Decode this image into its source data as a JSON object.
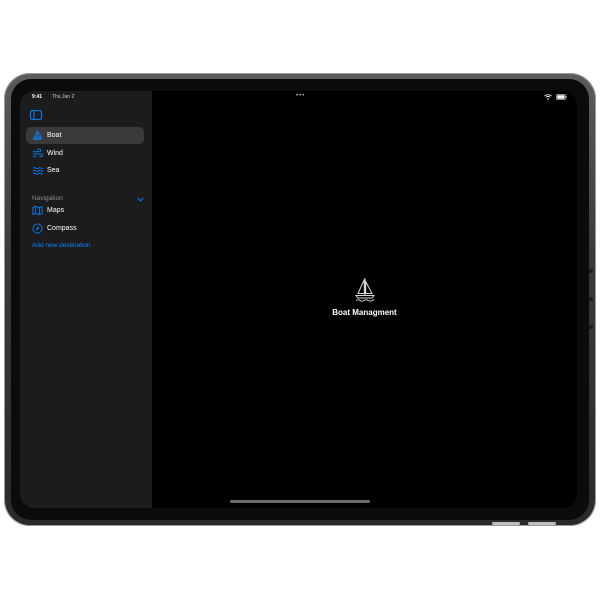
{
  "status_bar": {
    "time": "9:41",
    "date": "Thu Jan 2",
    "multitask_dots": "•••"
  },
  "sidebar": {
    "items": [
      {
        "label": "Boat",
        "icon": "sailboat-icon",
        "selected": true
      },
      {
        "label": "Wind",
        "icon": "wind-icon",
        "selected": false
      },
      {
        "label": "Sea",
        "icon": "waves-icon",
        "selected": false
      }
    ],
    "navigation_section": {
      "title": "Navigation",
      "expanded": true,
      "items": [
        {
          "label": "Maps",
          "icon": "map-icon"
        },
        {
          "label": "Compass",
          "icon": "compass-icon"
        }
      ]
    },
    "add_link": "Add new destination"
  },
  "detail": {
    "icon": "sailboat-icon",
    "title": "Boat Managment"
  },
  "colors": {
    "accent": "#0a84ff",
    "sidebar_bg": "#1c1c1e",
    "selected_bg": "#3a3a3c",
    "detail_bg": "#000000"
  }
}
